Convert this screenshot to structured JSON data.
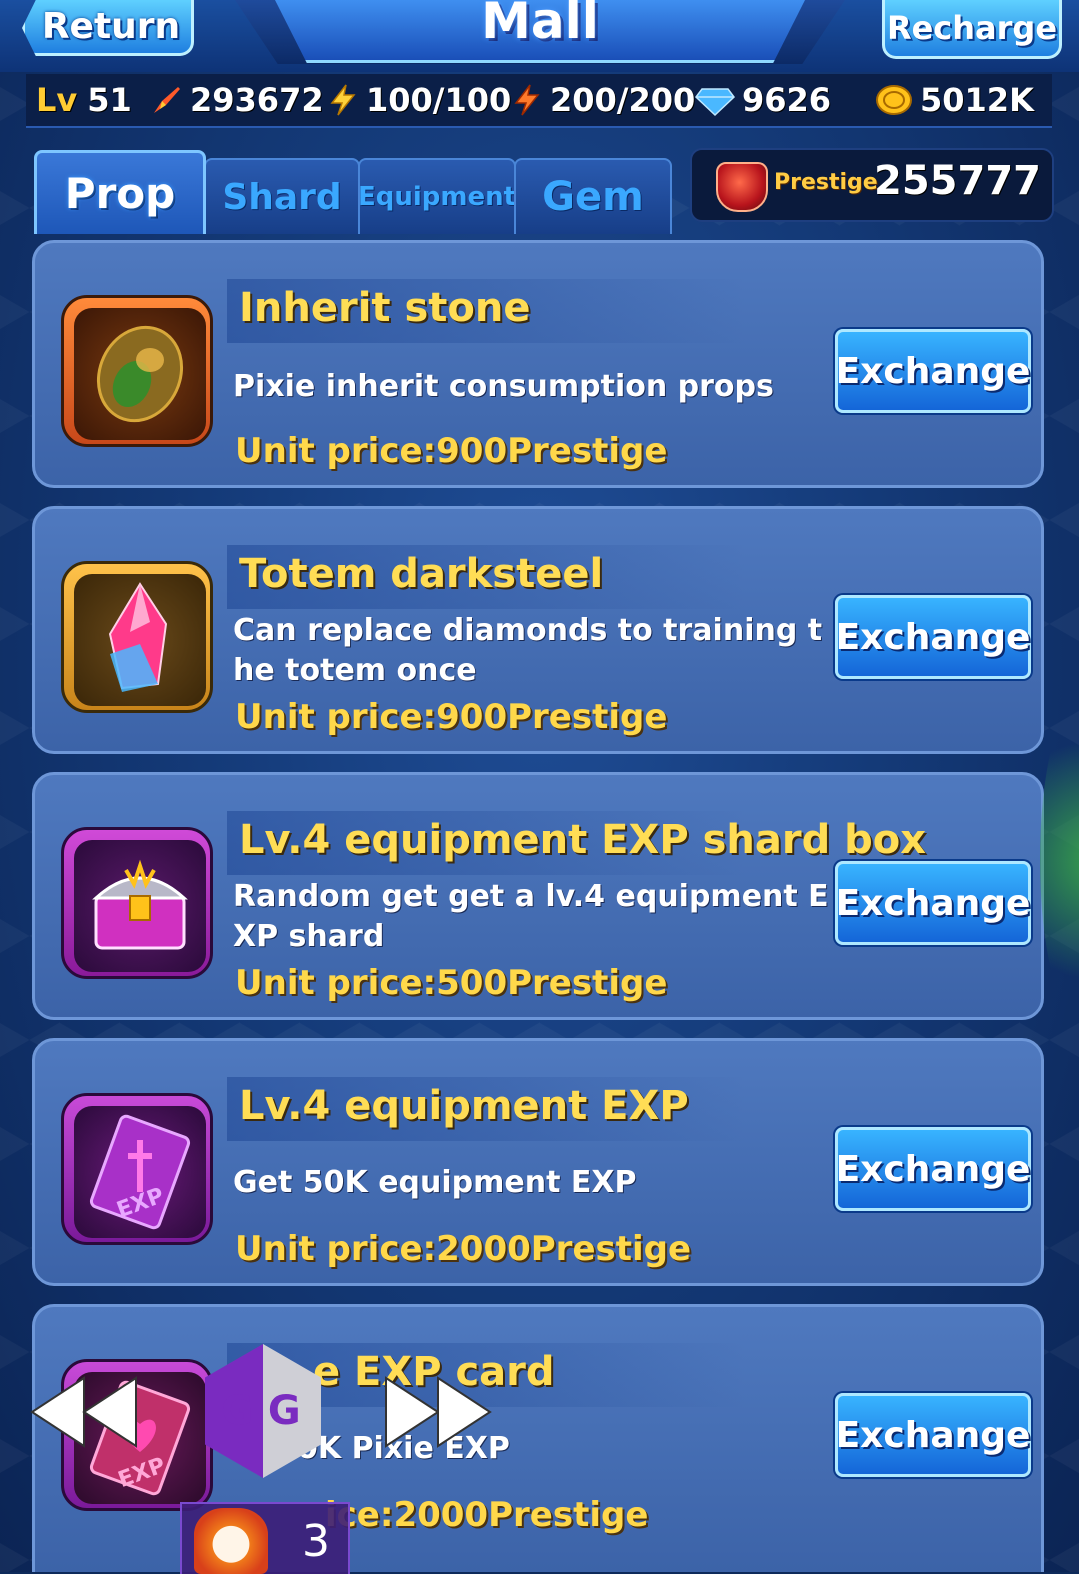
{
  "header": {
    "return_label": "Return",
    "title": "Mall",
    "recharge_label": "Recharge"
  },
  "stats": {
    "level_label": "Lv",
    "level_value": "51",
    "power": "293672",
    "energy": "100/100",
    "stamina": "200/200",
    "diamonds": "9626",
    "gold": "5012K"
  },
  "tabs": [
    {
      "label": "Prop",
      "active": true
    },
    {
      "label": "Shard",
      "active": false
    },
    {
      "label": "Equipment",
      "active": false
    },
    {
      "label": "Gem",
      "active": false
    }
  ],
  "prestige": {
    "label": "Prestige",
    "value": "255777"
  },
  "items": [
    {
      "name": "Inherit stone",
      "description": "Pixie inherit consumption props",
      "price": "Unit price:900Prestige",
      "button": "Exchange",
      "icon": "inherit-stone-icon"
    },
    {
      "name": "Totem darksteel",
      "description": "Can replace diamonds to training the totem once",
      "price": "Unit price:900Prestige",
      "button": "Exchange",
      "icon": "crystal-icon"
    },
    {
      "name": "Lv.4 equipment EXP shard box",
      "description": "Random get get a lv.4 equipment EXP shard",
      "price": "Unit price:500Prestige",
      "button": "Exchange",
      "icon": "treasure-chest-icon"
    },
    {
      "name": "Lv.4 equipment EXP",
      "description": "Get 50K equipment EXP",
      "price": "Unit price:2000Prestige",
      "button": "Exchange",
      "icon": "exp-card-icon"
    },
    {
      "name": "e EXP card",
      "description": "0K Pixie EXP",
      "price": "ice:2000Prestige",
      "button": "Exchange",
      "icon": "pixie-exp-card-icon"
    }
  ],
  "overlay": {
    "gg_label": "GG",
    "badge_count": "3"
  },
  "colors": {
    "accent": "#38b4ff",
    "name_gold": "#ffdd55",
    "price_gold": "#ffd84a",
    "panel": "#4a72b8"
  }
}
